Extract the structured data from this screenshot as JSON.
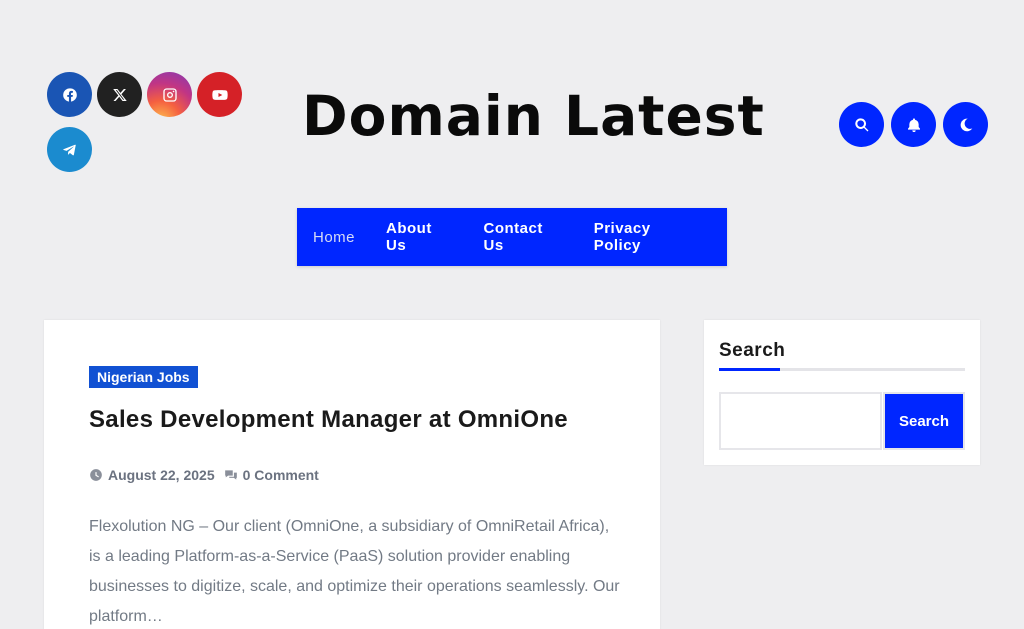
{
  "header": {
    "site_title": "Domain Latest",
    "social": [
      {
        "name": "facebook-icon",
        "color": "#1a55b4"
      },
      {
        "name": "x-twitter-icon",
        "color": "#212121"
      },
      {
        "name": "instagram-icon",
        "color": "#c13584"
      },
      {
        "name": "youtube-icon",
        "color": "#d52127"
      },
      {
        "name": "telegram-icon",
        "color": "#1b8bcf"
      }
    ],
    "actions": [
      "search-icon",
      "bell-icon",
      "moon-icon"
    ]
  },
  "nav": {
    "items": [
      "Home",
      "About Us",
      "Contact Us",
      "Privacy Policy"
    ],
    "active": "Home",
    "background": "#0026ff"
  },
  "post": {
    "category": "Nigerian Jobs",
    "title": "Sales Development Manager at OmniOne",
    "date": "August 22, 2025",
    "comments": "0 Comment",
    "excerpt": "Flexolution NG – Our client (OmniOne, a subsidiary of OmniRetail Africa), is a leading Platform-as-a-Service (PaaS) solution provider enabling businesses to digitize, scale, and optimize their operations seamlessly. Our platform…"
  },
  "sidebar": {
    "search_widget": {
      "title": "Search",
      "input_value": "",
      "input_placeholder": "",
      "button_label": "Search"
    }
  },
  "colors": {
    "accent": "#0026ff",
    "badge": "#1151d3",
    "page_bg": "#eeeef0"
  }
}
